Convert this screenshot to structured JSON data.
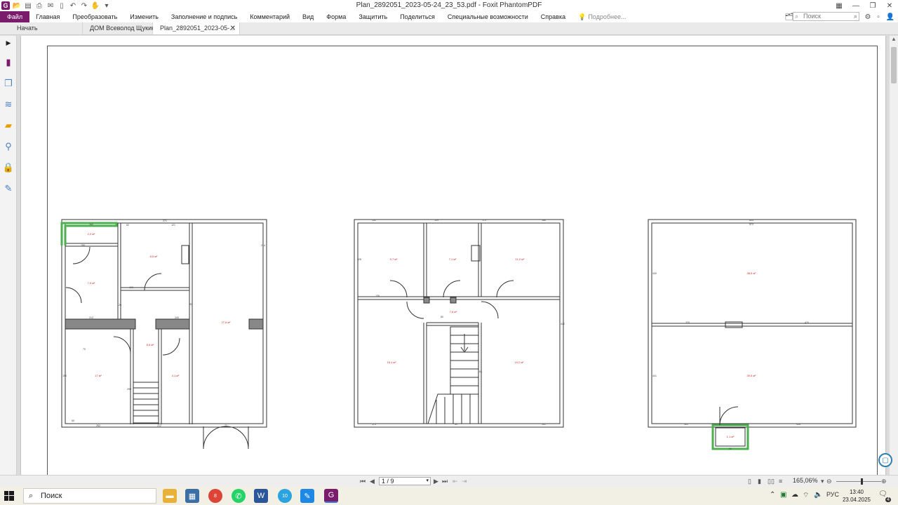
{
  "window": {
    "title": "Plan_2892051_2023-05-24_23_53.pdf - Foxit PhantomPDF",
    "logo_letter": "G"
  },
  "menu": {
    "items": [
      "Файл",
      "Главная",
      "Преобразовать",
      "Изменить",
      "Заполнение и подпись",
      "Комментарий",
      "Вид",
      "Форма",
      "Защитить",
      "Поделиться",
      "Специальные возможности",
      "Справка"
    ],
    "hint": "Подробнее...",
    "search_placeholder": "Поиск"
  },
  "tabs": [
    {
      "label": "Начать"
    },
    {
      "label": "ДОМ Всеволод Щукин..."
    },
    {
      "label": "Plan_2892051_2023-05-..."
    }
  ],
  "plans": {
    "floor1": {
      "areas": [
        "2,2 м²",
        "8,5 м²",
        "7,5 м²",
        "8,6 м²",
        "17 м²",
        "4,1 м²",
        "27,6 м²"
      ],
      "dims": [
        "340",
        "271",
        "82",
        "121",
        "156",
        "103",
        "212",
        "240",
        "155",
        "65",
        "252",
        "212",
        "72",
        "120",
        "214",
        "80",
        "290",
        "70"
      ]
    },
    "floor2": {
      "areas": [
        "9,7 м²",
        "7,1 м²",
        "11,2 м²",
        "7,6 м²",
        "16,4 м²",
        "19,2 м²"
      ],
      "dims": [
        "132",
        "109",
        "170",
        "188",
        "328",
        "412",
        "170",
        "141",
        "136",
        "80",
        "163",
        "64"
      ]
    },
    "floor3": {
      "areas": [
        "38,5 м²",
        "39,5 м²",
        "1,1 м²"
      ],
      "dims": [
        "855",
        "873",
        "320",
        "476",
        "430",
        "441",
        "302",
        "456",
        "96"
      ]
    }
  },
  "status": {
    "page_indicator": "1 / 9",
    "zoom": "165,06%"
  },
  "taskbar": {
    "search_label": "Поиск",
    "language": "РУС",
    "time": "13:40",
    "date": "23.04.2025",
    "notifications": "4",
    "telegram_badge": "10",
    "chrome_badge": "8"
  },
  "colors": {
    "brand": "#7a1b6b",
    "plan_label": "#d62828",
    "green_highlight": "#4caf50"
  }
}
